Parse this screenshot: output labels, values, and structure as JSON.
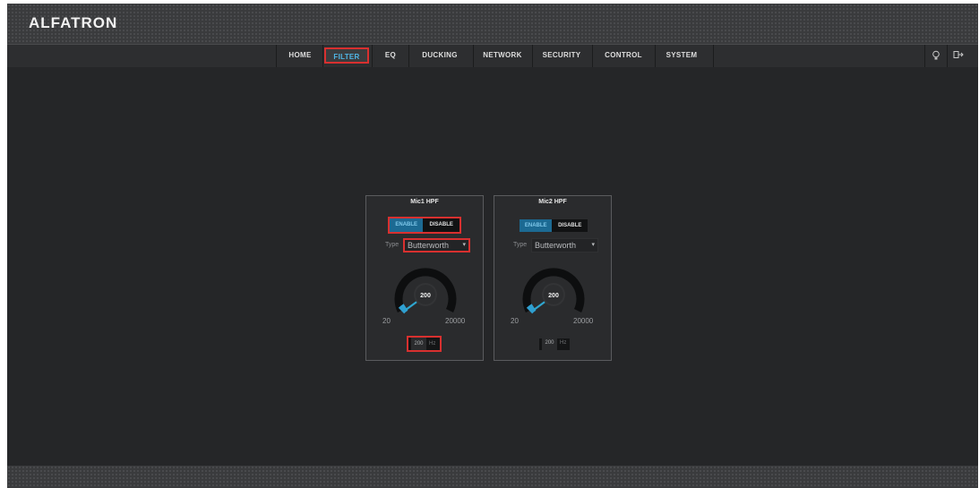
{
  "brand": {
    "logo_text": "ALFATRON"
  },
  "nav": {
    "items": [
      {
        "label": "HOME"
      },
      {
        "label": "FILTER"
      },
      {
        "label": "EQ"
      },
      {
        "label": "DUCKING"
      },
      {
        "label": "NETWORK"
      },
      {
        "label": "SECURITY"
      },
      {
        "label": "CONTROL"
      },
      {
        "label": "SYSTEM"
      }
    ],
    "active": "FILTER",
    "right_icons": [
      "lightbulb-icon",
      "logout-icon"
    ]
  },
  "colors": {
    "accent": "#4fb6e6",
    "highlight_border": "#d8302f",
    "background": "#252628",
    "toggle_on": "#1c6a93"
  },
  "panels": [
    {
      "title": "Mic1 HPF",
      "toggle": {
        "enable": "ENABLE",
        "disable": "DISABLE",
        "state": "ENABLE"
      },
      "type_label": "Type",
      "type_value": "Butterworth",
      "knob": {
        "value": "200",
        "min": "20",
        "max": "20000"
      },
      "frequency": {
        "value": "200",
        "unit": "Hz"
      }
    },
    {
      "title": "Mic2 HPF",
      "toggle": {
        "enable": "ENABLE",
        "disable": "DISABLE",
        "state": "ENABLE"
      },
      "type_label": "Type",
      "type_value": "Butterworth",
      "knob": {
        "value": "200",
        "min": "20",
        "max": "20000"
      },
      "frequency": {
        "value": "200",
        "unit": "Hz"
      }
    }
  ]
}
